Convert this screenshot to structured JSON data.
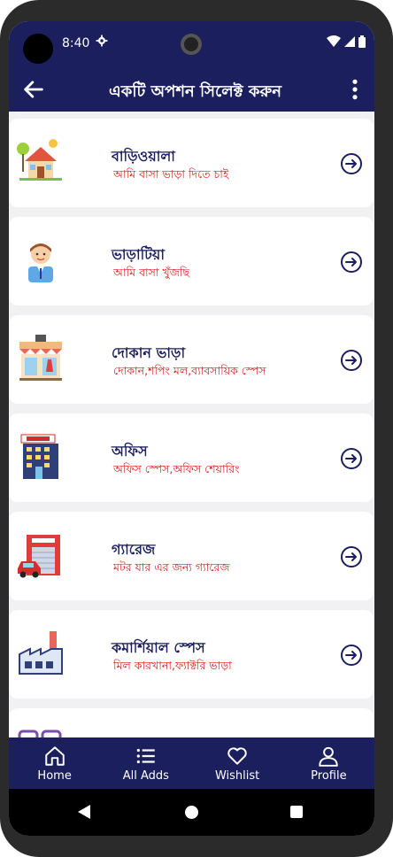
{
  "status_bar": {
    "time": "8:40",
    "icons": [
      "gear-icon",
      "wifi-icon",
      "signal-icon",
      "battery-icon"
    ]
  },
  "app_bar": {
    "title": "একটি অপশন সিলেক্ট করুন",
    "back_icon": "arrow-left-icon",
    "menu_icon": "more-vert-icon"
  },
  "options": [
    {
      "name": "বাড়িওয়ালা",
      "subtitle": "আমি বাসা ভাড়া দিতে চাই",
      "icon": "house-icon"
    },
    {
      "name": "ভাড়াটিয়া",
      "subtitle": "আমি বাসা খুঁজছি",
      "icon": "person-icon"
    },
    {
      "name": "দোকান ভাড়া",
      "subtitle": "দোকান,শপিং মল,ব্যাবসায়িক স্পেস",
      "icon": "shop-icon"
    },
    {
      "name": "অফিস",
      "subtitle": "অফিস স্পেস,অফিস শেয়ারিং",
      "icon": "office-building-icon"
    },
    {
      "name": "গ্যারেজ",
      "subtitle": "মটর যার এর জন্য গ্যারেজ",
      "icon": "garage-icon"
    },
    {
      "name": "কমার্শিয়াল স্পেস",
      "subtitle": "মিল কারখানা,ফ্যাক্টরি ভাড়া",
      "icon": "factory-icon"
    }
  ],
  "bottom_nav": [
    {
      "label": "Home",
      "icon": "home-icon"
    },
    {
      "label": "All Adds",
      "icon": "list-icon"
    },
    {
      "label": "Wishlist",
      "icon": "heart-icon"
    },
    {
      "label": "Profile",
      "icon": "user-icon"
    }
  ],
  "colors": {
    "primary": "#1b1f5e",
    "accent_text": "#d81e1e",
    "background": "#f1f1f4"
  }
}
